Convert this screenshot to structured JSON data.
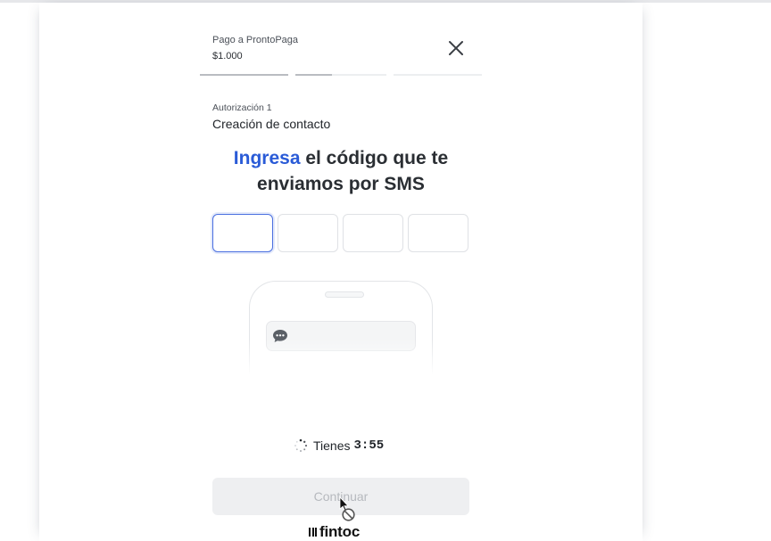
{
  "header": {
    "payment_label": "Pago a ProntoPaga",
    "amount": "$1.000",
    "close_icon": "close-icon"
  },
  "progress_steps": [
    {
      "state": "complete"
    },
    {
      "state": "current"
    },
    {
      "state": "pending"
    },
    {
      "state": "pending"
    }
  ],
  "auth": {
    "label": "Autorización 1",
    "title": "Creación de contacto"
  },
  "headline": {
    "accent": "Ingresa",
    "rest": " el código que te enviamos por SMS"
  },
  "code_inputs": [
    {
      "value": "",
      "focused": true
    },
    {
      "value": "",
      "focused": false
    },
    {
      "value": "",
      "focused": false
    },
    {
      "value": "",
      "focused": false
    }
  ],
  "illustration": {
    "icon": "chat-bubble-icon"
  },
  "timer": {
    "icon": "loading-spinner-icon",
    "label": "Tienes",
    "value": "3:55"
  },
  "continue_button": {
    "label": "Continuar",
    "disabled": true
  },
  "brand": {
    "name": "fintoc"
  },
  "colors": {
    "accent": "#2a5bd7",
    "focus_border": "#4a6fe0",
    "disabled_bg": "#eeeff1",
    "disabled_text": "#b6b9be"
  }
}
